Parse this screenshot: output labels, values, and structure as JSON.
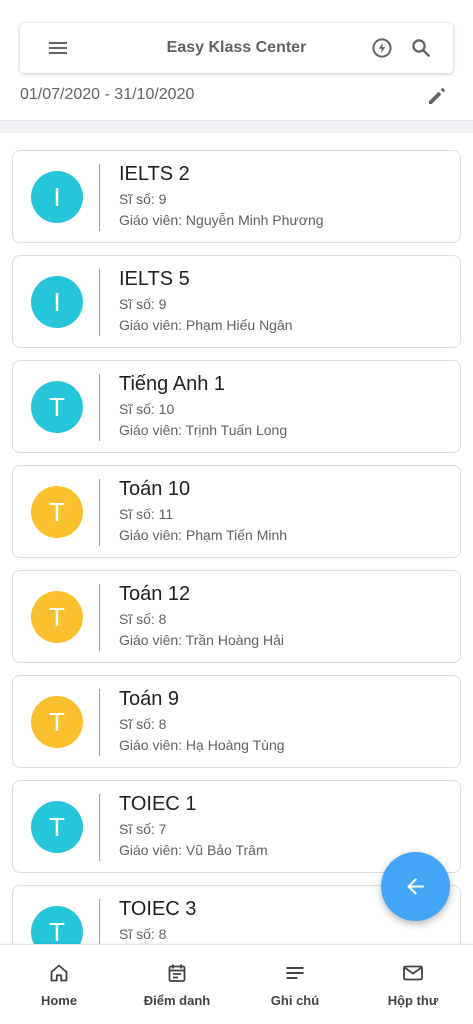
{
  "appbar": {
    "title": "Easy Klass Center"
  },
  "date_range": "01/07/2020 - 31/10/2020",
  "classes": [
    {
      "initial": "I",
      "name": "IELTS 2",
      "count": "Sĩ số: 9",
      "teacher": "Giáo viên: Nguyễn Minh Phương",
      "color": "#26c6da"
    },
    {
      "initial": "I",
      "name": "IELTS 5",
      "count": "Sĩ số: 9",
      "teacher": "Giáo viên: Phạm Hiếu Ngân",
      "color": "#26c6da"
    },
    {
      "initial": "T",
      "name": "Tiếng Anh 1",
      "count": "Sĩ số: 10",
      "teacher": "Giáo viên: Trịnh Tuấn Long",
      "color": "#26c6da"
    },
    {
      "initial": "T",
      "name": "Toán 10",
      "count": "Sĩ số: 11",
      "teacher": "Giáo viên: Phạm Tiến Minh",
      "color": "#fbc02d"
    },
    {
      "initial": "T",
      "name": "Toán 12",
      "count": "Sĩ số: 8",
      "teacher": "Giáo viên: Trần Hoàng Hải",
      "color": "#fbc02d"
    },
    {
      "initial": "T",
      "name": "Toán 9",
      "count": "Sĩ số: 8",
      "teacher": "Giáo viên: Hạ Hoàng Tùng",
      "color": "#fbc02d"
    },
    {
      "initial": "T",
      "name": "TOIEC 1",
      "count": "Sĩ số: 7",
      "teacher": "Giáo viên: Vũ Bảo Trâm",
      "color": "#26c6da"
    },
    {
      "initial": "T",
      "name": "TOIEC 3",
      "count": "Sĩ số: 8",
      "teacher": "",
      "color": "#26c6da"
    }
  ],
  "fab": {
    "icon": "arrow-left-icon",
    "color": "#42a5f5"
  },
  "bottom_nav": [
    {
      "label": "Home",
      "icon": "home-icon"
    },
    {
      "label": "Điểm danh",
      "icon": "calendar-icon"
    },
    {
      "label": "Ghi chú",
      "icon": "notes-icon"
    },
    {
      "label": "Hộp thư",
      "icon": "mail-icon"
    }
  ]
}
